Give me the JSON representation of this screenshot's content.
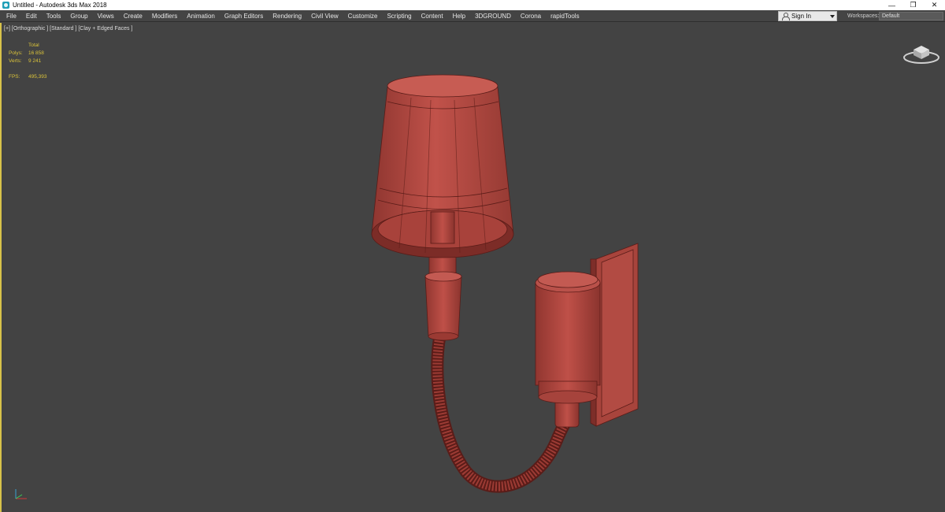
{
  "window": {
    "title": "Untitled - Autodesk 3ds Max 2018",
    "icon": "3ds-max-app-icon",
    "controls": {
      "minimize": "—",
      "restore": "❐",
      "close": "✕"
    }
  },
  "menu": {
    "items": [
      "File",
      "Edit",
      "Tools",
      "Group",
      "Views",
      "Create",
      "Modifiers",
      "Animation",
      "Graph Editors",
      "Rendering",
      "Civil View",
      "Customize",
      "Scripting",
      "Content",
      "Help",
      "3DGROUND",
      "Corona",
      "rapidTools"
    ],
    "sign_in": "Sign In",
    "workspaces_label": "Workspaces:",
    "workspace_value": "Default"
  },
  "viewport": {
    "label": "[+] [Orthographic ] [Standard ] [Clay + Edged Faces ]",
    "stats": {
      "header": "Total",
      "polys_label": "Polys:",
      "polys_value": "16 858",
      "verts_label": "Verts:",
      "verts_value": "9 241",
      "fps_label": "FPS:",
      "fps_value": "495,393"
    }
  },
  "colors": {
    "viewport_bg": "#434343",
    "model_fill": "#b34840",
    "wire": "#5a1c18",
    "stats_text": "#d9c23a",
    "active_border": "#d8c24a"
  }
}
